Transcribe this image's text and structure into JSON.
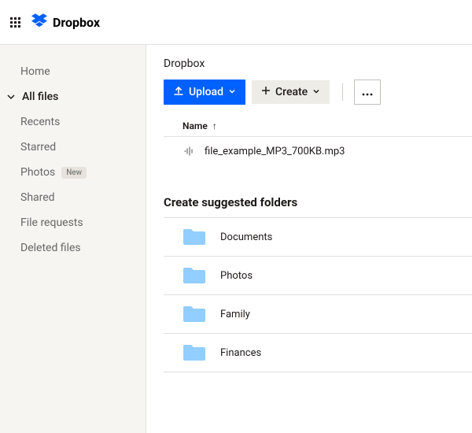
{
  "brand": {
    "name": "Dropbox"
  },
  "sidebar": {
    "items": [
      {
        "label": "Home"
      },
      {
        "label": "All files"
      },
      {
        "label": "Recents"
      },
      {
        "label": "Starred"
      },
      {
        "label": "Photos",
        "badge": "New"
      },
      {
        "label": "Shared"
      },
      {
        "label": "File requests"
      },
      {
        "label": "Deleted files"
      }
    ]
  },
  "breadcrumb": "Dropbox",
  "toolbar": {
    "upload_label": "Upload",
    "create_label": "Create"
  },
  "table": {
    "name_col": "Name"
  },
  "files": [
    {
      "name": "file_example_MP3_700KB.mp3"
    }
  ],
  "suggested": {
    "heading": "Create suggested folders",
    "items": [
      {
        "name": "Documents"
      },
      {
        "name": "Photos"
      },
      {
        "name": "Family"
      },
      {
        "name": "Finances"
      }
    ]
  },
  "colors": {
    "brand_blue": "#0061fe",
    "folder_blue": "#92ceff"
  }
}
